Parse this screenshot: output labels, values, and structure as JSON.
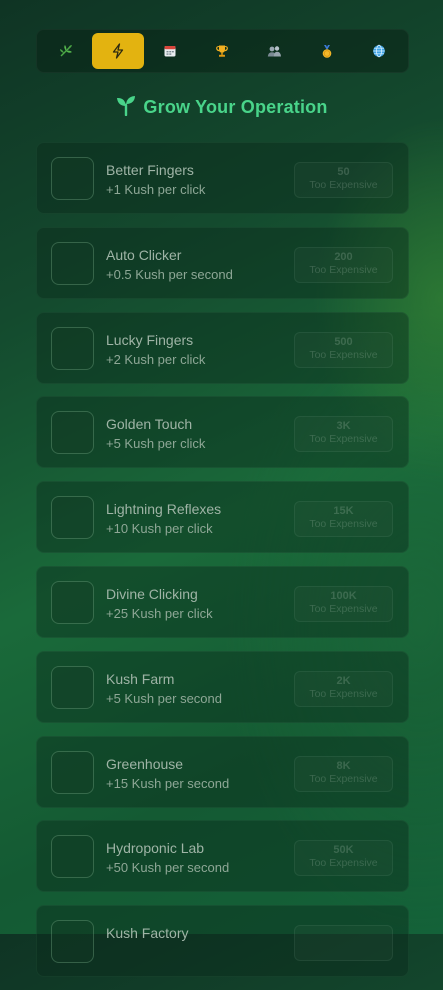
{
  "tabs": [
    {
      "icon": "leaf-icon",
      "active": false
    },
    {
      "icon": "lightning-icon",
      "active": true
    },
    {
      "icon": "calendar-icon",
      "active": false
    },
    {
      "icon": "trophy-icon",
      "active": false
    },
    {
      "icon": "users-icon",
      "active": false
    },
    {
      "icon": "medal-icon",
      "active": false
    },
    {
      "icon": "globe-icon",
      "active": false
    }
  ],
  "colors": {
    "accent": "#e3b310",
    "heading": "#49d48a"
  },
  "heading": {
    "icon": "sprout-icon",
    "title": "Grow Your Operation"
  },
  "upgrades": [
    {
      "name": "Better Fingers",
      "description": "+1 Kush per click",
      "price": "50",
      "status": "Too Expensive"
    },
    {
      "name": "Auto Clicker",
      "description": "+0.5 Kush per second",
      "price": "200",
      "status": "Too Expensive"
    },
    {
      "name": "Lucky Fingers",
      "description": "+2 Kush per click",
      "price": "500",
      "status": "Too Expensive"
    },
    {
      "name": "Golden Touch",
      "description": "+5 Kush per click",
      "price": "3K",
      "status": "Too Expensive"
    },
    {
      "name": "Lightning Reflexes",
      "description": "+10 Kush per click",
      "price": "15K",
      "status": "Too Expensive"
    },
    {
      "name": "Divine Clicking",
      "description": "+25 Kush per click",
      "price": "100K",
      "status": "Too Expensive"
    },
    {
      "name": "Kush Farm",
      "description": "+5 Kush per second",
      "price": "2K",
      "status": "Too Expensive"
    },
    {
      "name": "Greenhouse",
      "description": "+15 Kush per second",
      "price": "8K",
      "status": "Too Expensive"
    },
    {
      "name": "Hydroponic Lab",
      "description": "+50 Kush per second",
      "price": "50K",
      "status": "Too Expensive"
    },
    {
      "name": "Kush Factory",
      "description": "",
      "price": "",
      "status": ""
    }
  ]
}
